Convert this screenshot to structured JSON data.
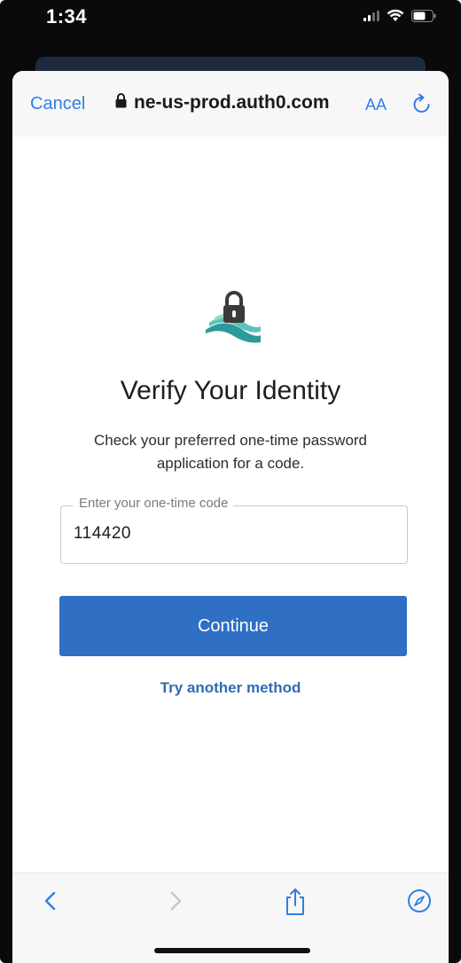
{
  "status_bar": {
    "time": "1:34"
  },
  "browser": {
    "cancel_label": "Cancel",
    "url": "ne-us-prod.auth0.com",
    "text_size_label": "AA"
  },
  "page": {
    "title": "Verify Your Identity",
    "instruction_line1": "Check your preferred one-time password",
    "instruction_line2": "application for a code.",
    "code_field_label": "Enter your one-time code",
    "code_value": "114420",
    "continue_label": "Continue",
    "alternate_method_label": "Try another method"
  },
  "colors": {
    "accent": "#2f7ee6",
    "primary_button": "#2f6fc4",
    "link": "#2a6db0"
  },
  "icons": {
    "lock": "lock-icon",
    "reload": "reload-icon",
    "back": "chevron-left-icon",
    "forward": "chevron-right-icon",
    "share": "share-icon",
    "compass": "compass-icon"
  }
}
